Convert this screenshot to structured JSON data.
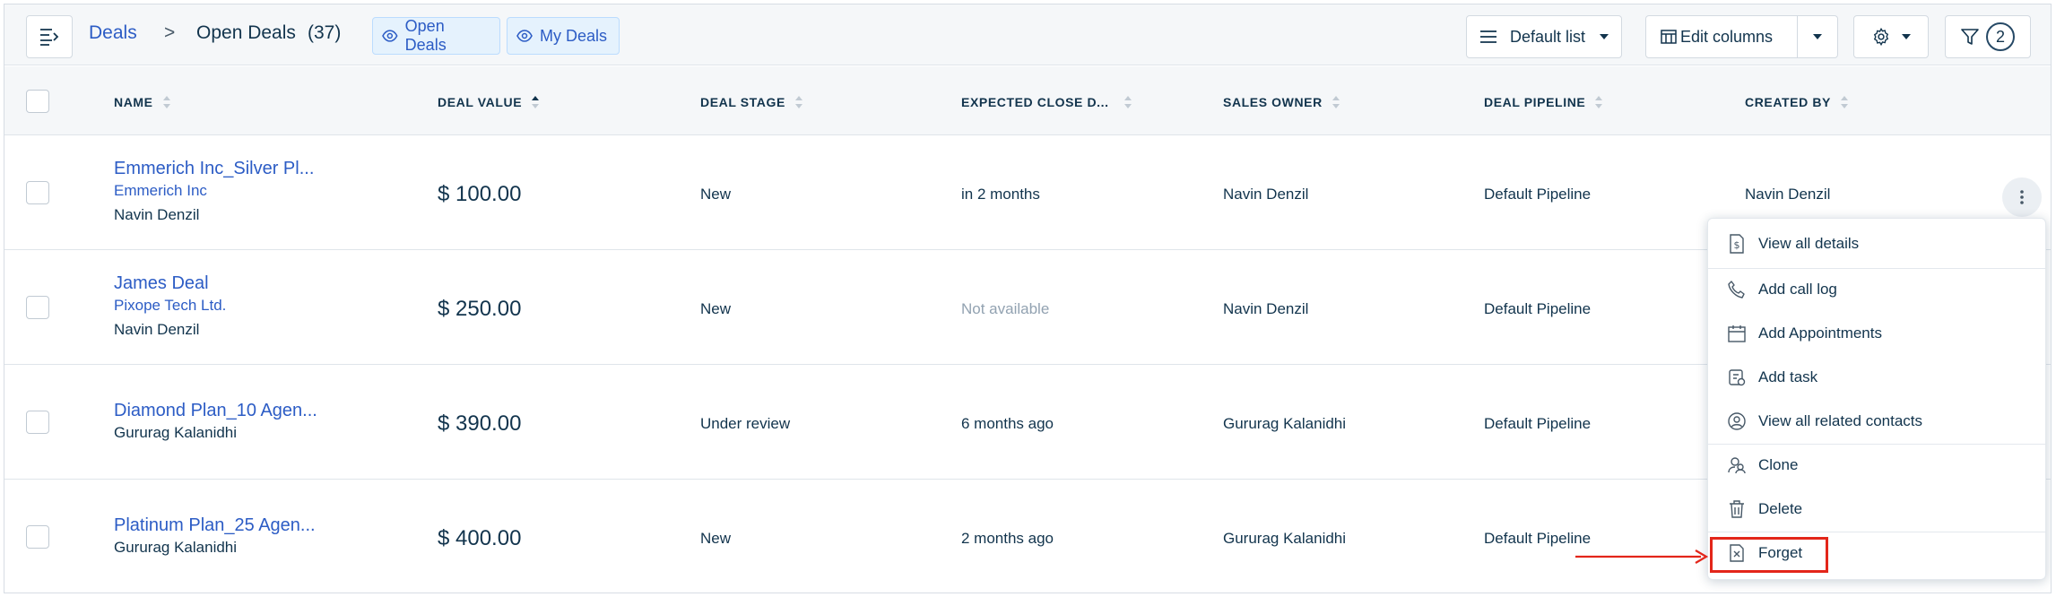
{
  "breadcrumb": {
    "root": "Deals",
    "separator": ">",
    "title": "Open Deals",
    "count": "(37)"
  },
  "view_tabs": [
    {
      "label": "Open Deals"
    },
    {
      "label": "My Deals"
    }
  ],
  "toolbar": {
    "list_label": "Default list",
    "edit_columns_label": "Edit columns",
    "filter_count": "2"
  },
  "columns": [
    {
      "label": "NAME",
      "sort": "none"
    },
    {
      "label": "DEAL VALUE",
      "sort": "asc"
    },
    {
      "label": "DEAL STAGE",
      "sort": "none"
    },
    {
      "label": "EXPECTED CLOSE D...",
      "sort": "none"
    },
    {
      "label": "SALES OWNER",
      "sort": "none"
    },
    {
      "label": "DEAL PIPELINE",
      "sort": "none"
    },
    {
      "label": "CREATED BY",
      "sort": "none"
    }
  ],
  "rows": [
    {
      "name": "Emmerich Inc_Silver Pl...",
      "company": "Emmerich Inc",
      "contact": "Navin Denzil",
      "value": "$ 100.00",
      "stage": "New",
      "close": "in 2 months",
      "close_muted": false,
      "owner": "Navin Denzil",
      "pipeline": "Default Pipeline",
      "created_by": "Navin Denzil"
    },
    {
      "name": "James Deal",
      "company": "Pixope Tech Ltd.",
      "contact": "Navin Denzil",
      "value": "$ 250.00",
      "stage": "New",
      "close": "Not available",
      "close_muted": true,
      "owner": "Navin Denzil",
      "pipeline": "Default Pipeline",
      "created_by": ""
    },
    {
      "name": "Diamond Plan_10 Agen...",
      "company": "",
      "contact": "Gururag Kalanidhi",
      "value": "$ 390.00",
      "stage": "Under review",
      "close": "6 months ago",
      "close_muted": false,
      "owner": "Gururag Kalanidhi",
      "pipeline": "Default Pipeline",
      "created_by": ""
    },
    {
      "name": "Platinum Plan_25 Agen...",
      "company": "",
      "contact": "Gururag Kalanidhi",
      "value": "$ 400.00",
      "stage": "New",
      "close": "2 months ago",
      "close_muted": false,
      "owner": "Gururag Kalanidhi",
      "pipeline": "Default Pipeline",
      "created_by": ""
    }
  ],
  "row_menu": {
    "items": [
      {
        "label": "View all details",
        "icon": "dollar-doc-icon"
      },
      {
        "label": "Add call log",
        "icon": "phone-icon"
      },
      {
        "label": "Add Appointments",
        "icon": "calendar-icon"
      },
      {
        "label": "Add task",
        "icon": "task-icon"
      },
      {
        "label": "View all related contacts",
        "icon": "contact-icon"
      },
      {
        "label": "Clone",
        "icon": "clone-icon"
      },
      {
        "label": "Delete",
        "icon": "trash-icon"
      },
      {
        "label": "Forget",
        "icon": "forget-icon"
      }
    ]
  },
  "colors": {
    "link": "#2c5cc5",
    "text": "#12344d",
    "highlight": "#e3261a",
    "tab_bg": "#e5f2fd"
  }
}
